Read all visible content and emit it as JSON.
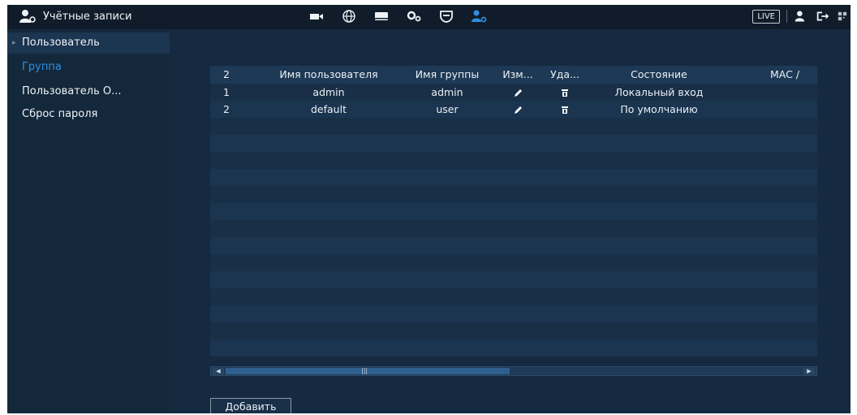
{
  "header": {
    "title": "Учётные записи",
    "live_label": "LIVE",
    "nav_icons": [
      "camera-icon",
      "network-icon",
      "storage-icon",
      "settings-icon",
      "security-icon",
      "accounts-icon"
    ],
    "colors": {
      "active_icon": "#2f8fe0"
    }
  },
  "sidebar": {
    "items": [
      {
        "label": "Пользователь"
      },
      {
        "label": "Группа"
      },
      {
        "label": "Пользователь О..."
      },
      {
        "label": "Сброс пароля"
      }
    ]
  },
  "table": {
    "columns": [
      "2",
      "Имя пользователя",
      "Имя группы",
      "Изм...",
      "Уда...",
      "Состояние",
      "MAC /"
    ],
    "rows": [
      {
        "num": "1",
        "user": "admin",
        "group": "admin",
        "state": "Локальный вход"
      },
      {
        "num": "2",
        "user": "default",
        "group": "user",
        "state": "По умолчанию"
      }
    ]
  },
  "add_button": "Добавить"
}
